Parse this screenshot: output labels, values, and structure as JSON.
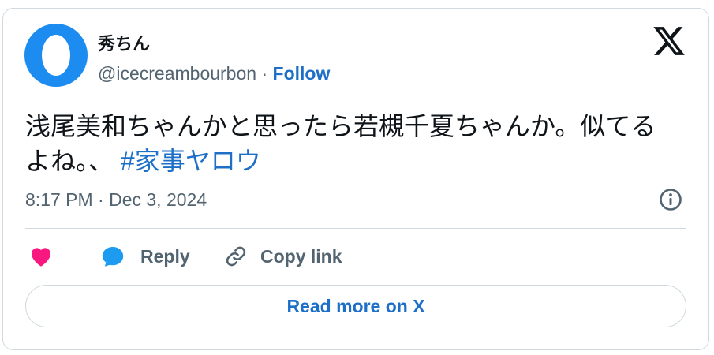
{
  "author": {
    "display_name": "秀ちん",
    "handle": "@icecreambourbon",
    "separator": "·",
    "follow_label": "Follow"
  },
  "tweet": {
    "text": "浅尾美和ちゃんかと思ったら若槻千夏ちゃんか。似てるよね。、",
    "hashtag": "#家事ヤロウ",
    "timestamp": "8:17 PM · Dec 3, 2024"
  },
  "actions": {
    "reply_label": "Reply",
    "copy_link_label": "Copy link"
  },
  "read_more_label": "Read more on X",
  "colors": {
    "accent": "#1d6fc7",
    "like": "#f91880",
    "avatar": "#1d8cf0",
    "muted": "#536471"
  },
  "icons": [
    "x-logo-icon",
    "info-icon",
    "heart-icon",
    "reply-bubble-icon",
    "link-icon"
  ]
}
